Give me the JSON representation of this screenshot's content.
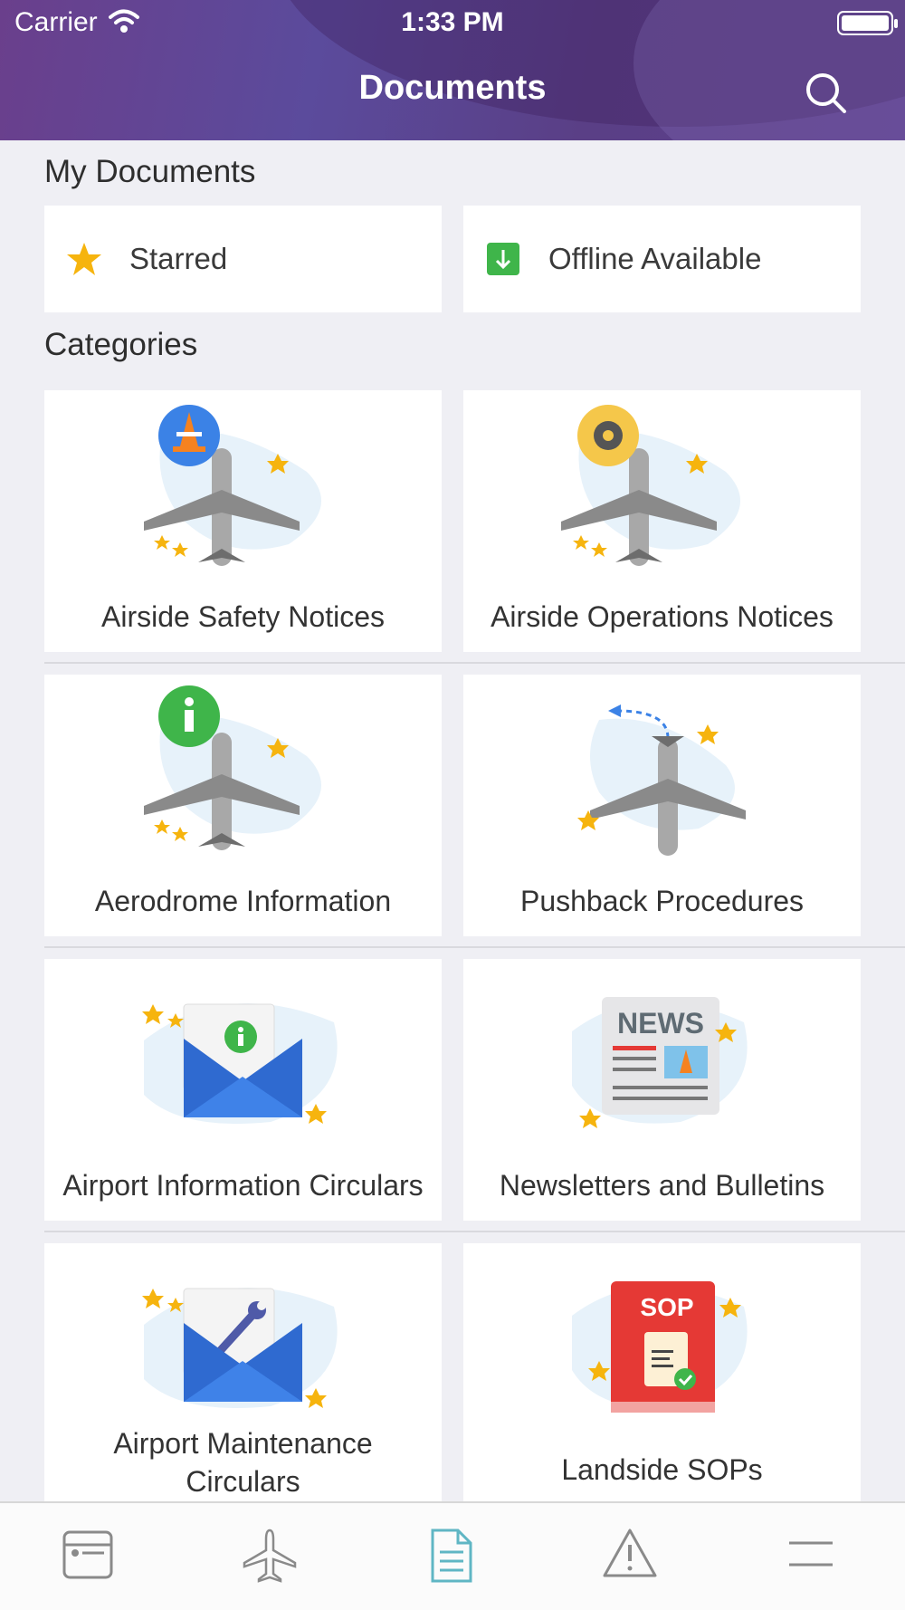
{
  "status_bar": {
    "carrier": "Carrier",
    "time": "1:33 PM"
  },
  "header": {
    "title": "Documents",
    "search_icon": "search-icon"
  },
  "my_documents": {
    "title": "My Documents",
    "items": [
      {
        "label": "Starred",
        "icon": "star-icon"
      },
      {
        "label": "Offline Available",
        "icon": "download-icon"
      }
    ]
  },
  "categories": {
    "title": "Categories",
    "items": [
      {
        "label": "Airside Safety Notices",
        "icon": "plane-cone-icon"
      },
      {
        "label": "Airside Operations Notices",
        "icon": "plane-gear-icon"
      },
      {
        "label": "Aerodrome Information",
        "icon": "plane-info-icon"
      },
      {
        "label": "Pushback Procedures",
        "icon": "pushback-plane-icon"
      },
      {
        "label": "Airport Information Circulars",
        "icon": "envelope-info-icon"
      },
      {
        "label": "Newsletters and Bulletins",
        "icon": "newspaper-icon",
        "badge": "NEWS"
      },
      {
        "label": "Airport Maintenance Circulars",
        "icon": "envelope-wrench-icon"
      },
      {
        "label": "Landside SOPs",
        "icon": "sop-book-icon",
        "badge": "SOP"
      }
    ]
  },
  "tabbar": {
    "tabs": [
      {
        "name": "dashboard",
        "icon": "card-icon"
      },
      {
        "name": "flights",
        "icon": "airplane-icon"
      },
      {
        "name": "documents",
        "icon": "document-icon",
        "active": true
      },
      {
        "name": "alerts",
        "icon": "warning-icon"
      },
      {
        "name": "menu",
        "icon": "menu-icon"
      }
    ]
  },
  "colors": {
    "header_start": "#6a3f8c",
    "header_end": "#5d3f8c",
    "star": "#f6b40e",
    "offline_green": "#3fb54a",
    "active_tab": "#5fb6c4",
    "inactive_tab": "#8a8a8a"
  }
}
